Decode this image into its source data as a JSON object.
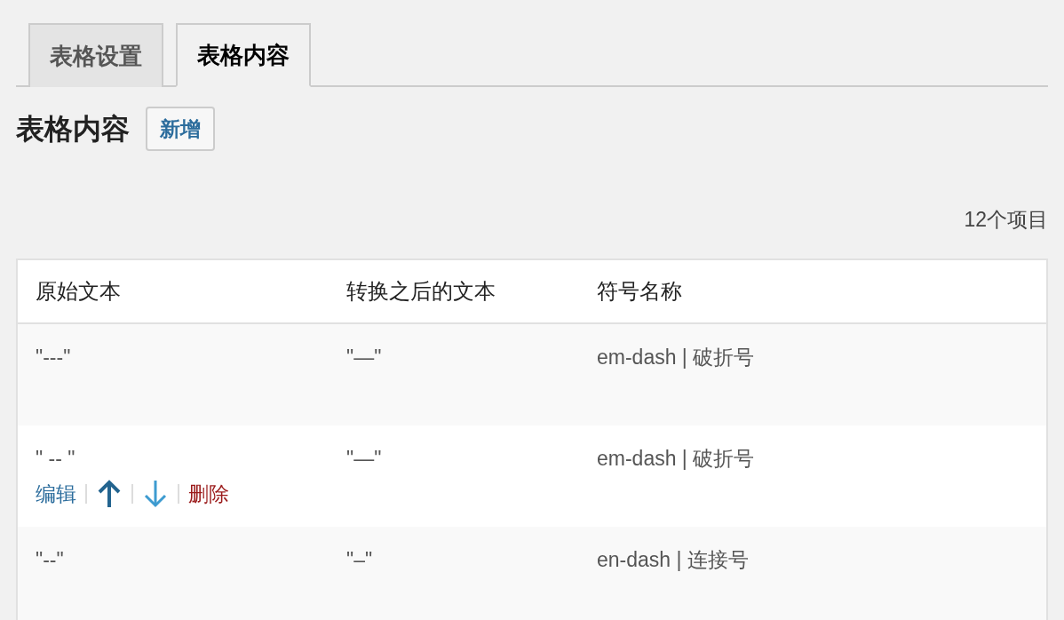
{
  "tabs": [
    {
      "label": "表格设置",
      "selected": false
    },
    {
      "label": "表格内容",
      "selected": true
    }
  ],
  "heading": "表格内容",
  "add_button": "新增",
  "item_count": "12个项目",
  "table": {
    "columns": [
      "原始文本",
      "转换之后的文本",
      "符号名称"
    ],
    "rows": [
      {
        "cells": [
          "\"---\"",
          "\"—\"",
          "em-dash | 破折号"
        ]
      },
      {
        "cells": [
          "\" -- \"",
          "\"—\"",
          "em-dash | 破折号"
        ],
        "actions": [
          {
            "kind": "edit",
            "label": "编辑"
          },
          {
            "kind": "up"
          },
          {
            "kind": "down"
          },
          {
            "kind": "delete",
            "label": "删除"
          }
        ]
      },
      {
        "cells": [
          "\"--\"",
          "\"–\"",
          "en-dash | 连接号"
        ]
      }
    ]
  }
}
